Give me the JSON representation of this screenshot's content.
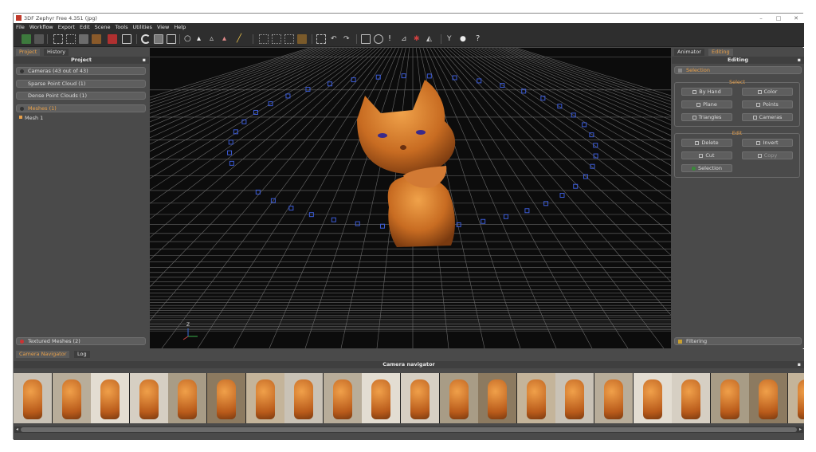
{
  "window": {
    "title": "3DF Zephyr Free 4.351 (jpg)",
    "controls": [
      "–",
      "□",
      "✕"
    ]
  },
  "menu": [
    "File",
    "Workflow",
    "Export",
    "Edit",
    "Scene",
    "Tools",
    "Utilities",
    "View",
    "Help"
  ],
  "left_panel": {
    "tabs": [
      "Project",
      "History"
    ],
    "header": "Project",
    "items": [
      {
        "label": "Cameras (43 out of 43)"
      },
      {
        "label": "Sparse Point Cloud (1)"
      },
      {
        "label": "Dense Point Clouds (1)"
      },
      {
        "label": "Meshes (1)"
      }
    ],
    "mesh_child": "Mesh 1",
    "footer_item": "Textured Meshes (2)"
  },
  "right_panel": {
    "tabs": [
      "Animator",
      "Editing"
    ],
    "header": "Editing",
    "selection_label": "Selection",
    "select_group": "Select",
    "select_buttons": [
      "By Hand",
      "Color",
      "Plane",
      "Points",
      "Triangles",
      "Cameras"
    ],
    "edit_group": "Edit",
    "edit_buttons": [
      "Delete",
      "Invert",
      "Cut",
      "Copy",
      "Selection"
    ],
    "filtering_label": "Filtering"
  },
  "viewport": {
    "axis_label": "Z"
  },
  "bottom_panel": {
    "tabs": [
      "Camera Navigator",
      "Log"
    ],
    "header": "Camera navigator",
    "thumbnail_count": 21
  },
  "colors": {
    "accent": "#e8a04a",
    "panel": "#4a4a4a",
    "viewport": "#0c0c0c",
    "camera_marker": "#3b5bd6"
  }
}
